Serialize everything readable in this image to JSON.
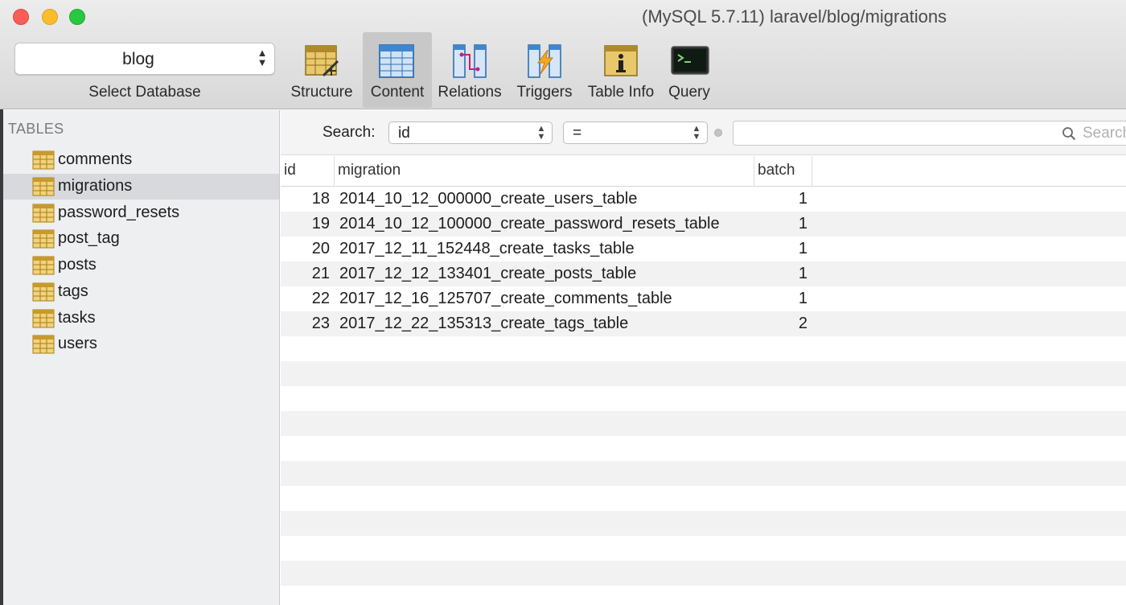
{
  "window": {
    "title": "(MySQL 5.7.11) laravel/blog/migrations"
  },
  "database_selector": {
    "value": "blog",
    "caption": "Select Database"
  },
  "toolbar": {
    "structure": "Structure",
    "content": "Content",
    "relations": "Relations",
    "triggers": "Triggers",
    "table_info": "Table Info",
    "query": "Query",
    "active": "Content"
  },
  "sidebar": {
    "heading": "TABLES",
    "tables": [
      "comments",
      "migrations",
      "password_resets",
      "post_tag",
      "posts",
      "tags",
      "tasks",
      "users"
    ],
    "selected": "migrations"
  },
  "filter": {
    "label": "Search:",
    "field": "id",
    "operator": "=",
    "placeholder": "Search"
  },
  "grid": {
    "columns": [
      "id",
      "migration",
      "batch"
    ],
    "rows": [
      {
        "id": "18",
        "migration": "2014_10_12_000000_create_users_table",
        "batch": "1"
      },
      {
        "id": "19",
        "migration": "2014_10_12_100000_create_password_resets_table",
        "batch": "1"
      },
      {
        "id": "20",
        "migration": "2017_12_11_152448_create_tasks_table",
        "batch": "1"
      },
      {
        "id": "21",
        "migration": "2017_12_12_133401_create_posts_table",
        "batch": "1"
      },
      {
        "id": "22",
        "migration": "2017_12_16_125707_create_comments_table",
        "batch": "1"
      },
      {
        "id": "23",
        "migration": "2017_12_22_135313_create_tags_table",
        "batch": "2"
      }
    ]
  },
  "colors": {
    "close": "#fc5d57",
    "minimize": "#fdbc2e",
    "zoom": "#28c840",
    "selection": "#d8d9dc",
    "row_alt": "#f2f2f2"
  }
}
